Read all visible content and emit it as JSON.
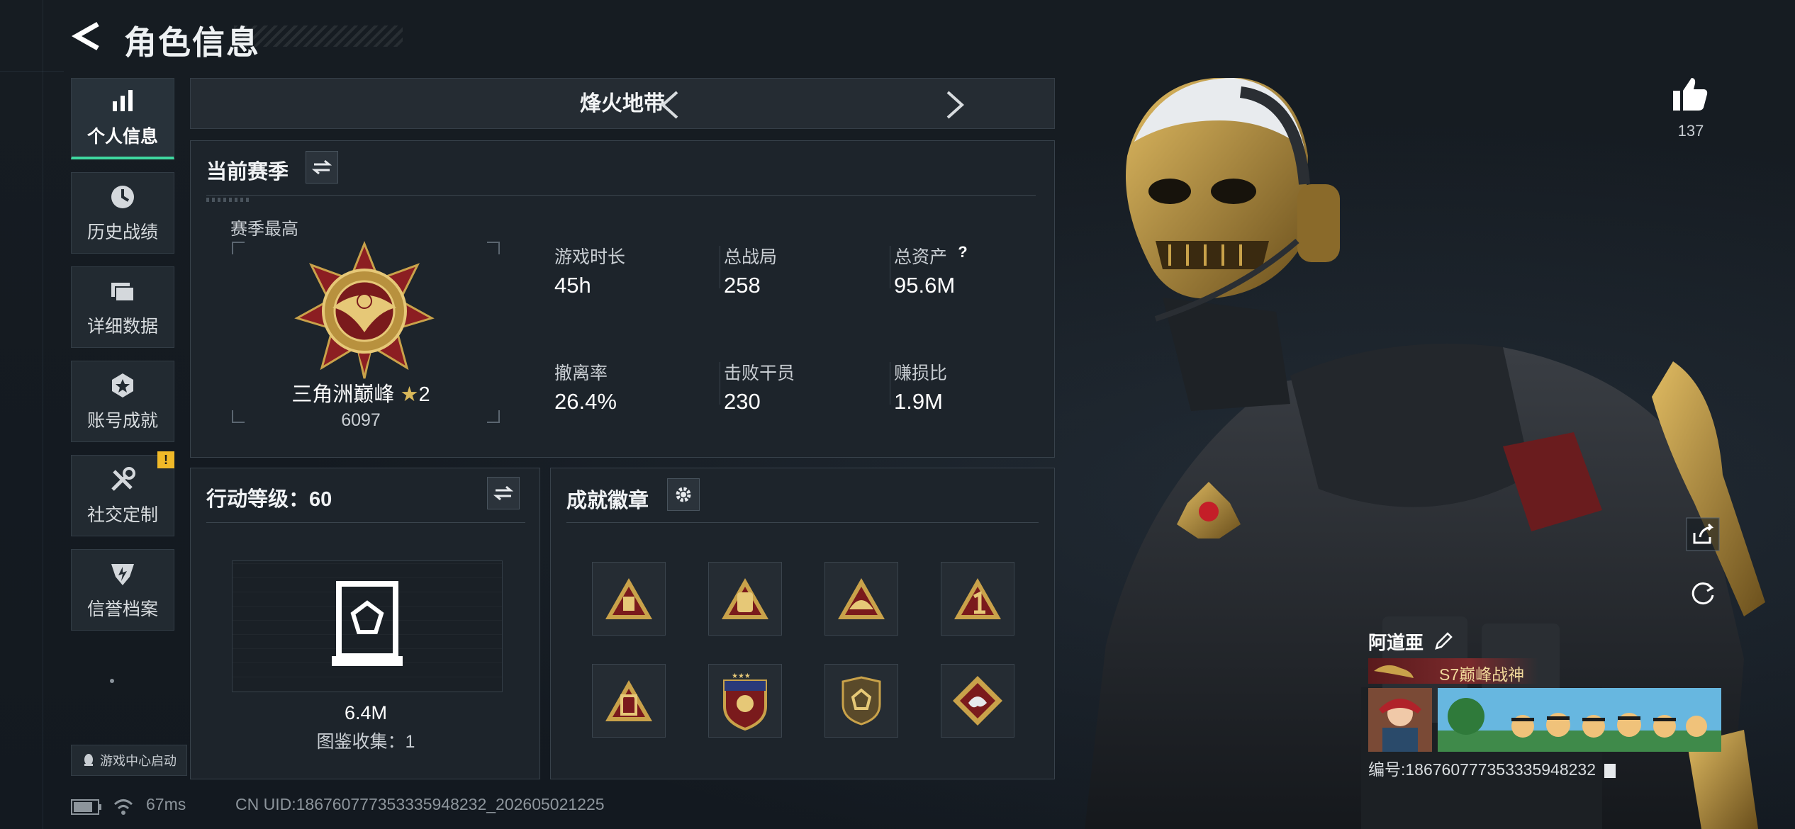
{
  "header": {
    "title": "角色信息"
  },
  "sidebar": {
    "items": [
      {
        "label": "个人信息",
        "icon": "bar-chart-icon",
        "active": true
      },
      {
        "label": "历史战绩",
        "icon": "clock-icon"
      },
      {
        "label": "详细数据",
        "icon": "folder-icon"
      },
      {
        "label": "账号成就",
        "icon": "achievement-icon"
      },
      {
        "label": "社交定制",
        "icon": "tools-icon",
        "badge": "!"
      },
      {
        "label": "信誉档案",
        "icon": "shield-icon"
      }
    ],
    "game_center_label": "游戏中心启动"
  },
  "mode": {
    "label": "烽火地带"
  },
  "season": {
    "title": "当前赛季",
    "best_label": "赛季最高",
    "rank_name": "三角洲巅峰",
    "rank_stars": "2",
    "rank_score": "6097",
    "stats": [
      {
        "label": "游戏时长",
        "value": "45h"
      },
      {
        "label": "总战局",
        "value": "258"
      },
      {
        "label": "总资产",
        "value": "95.6M",
        "help": "?"
      },
      {
        "label": "撤离率",
        "value": "26.4%"
      },
      {
        "label": "击败干员",
        "value": "230"
      },
      {
        "label": "赚损比",
        "value": "1.9M"
      }
    ]
  },
  "action_level": {
    "title": "行动等级：60",
    "value": "6.4M",
    "collection": "图鉴收集：1"
  },
  "badges": {
    "title": "成就徽章",
    "items": [
      "badge-1",
      "badge-2",
      "badge-3",
      "badge-4",
      "badge-5",
      "badge-6",
      "badge-7",
      "badge-8"
    ]
  },
  "player": {
    "likes": "137",
    "name": "阿道亜",
    "title_tag": "S7巅峰战神",
    "id_text": "编号:18676077735333594823​2"
  },
  "footer": {
    "ping": "67ms",
    "uid": "CN UID:18676077735333594823​2_202605021225"
  },
  "colors": {
    "accent": "#3fd8a0",
    "warning": "#f0b928",
    "gold": "#c9a24a"
  }
}
